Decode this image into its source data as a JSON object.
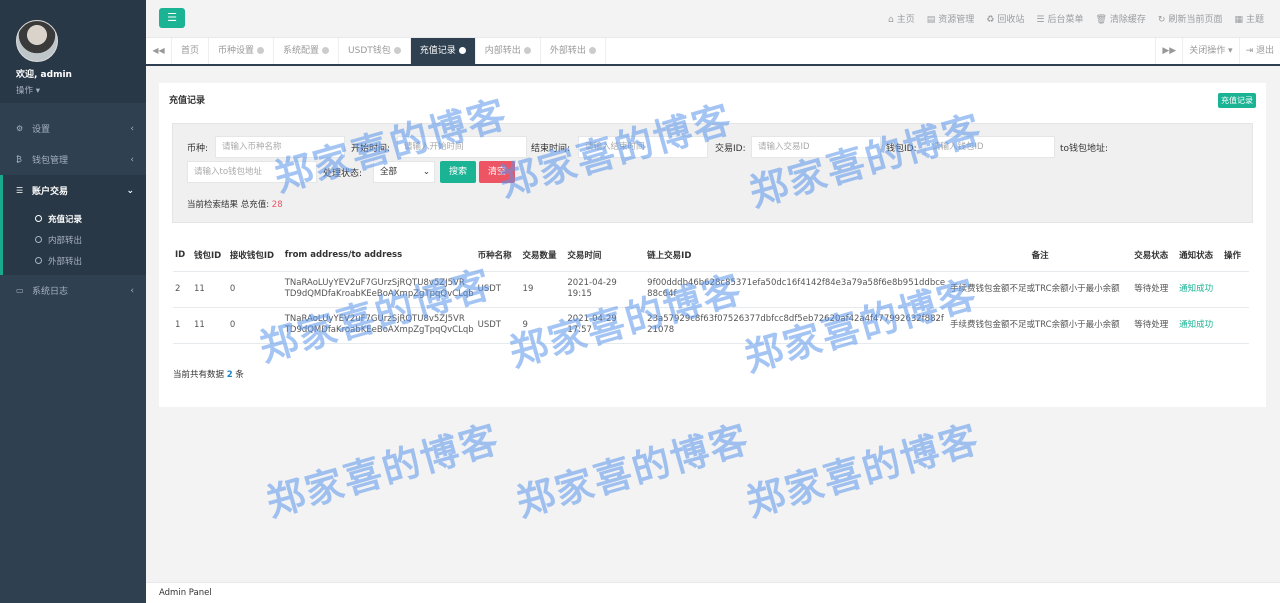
{
  "sidebar": {
    "welcome": "欢迎, admin",
    "ops": "操作 ▾",
    "menu": [
      {
        "label": "设置",
        "icon": "gears-icon"
      },
      {
        "label": "钱包管理",
        "icon": "bitcoin-icon"
      },
      {
        "label": "账户交易",
        "icon": "list-icon"
      },
      {
        "label": "系统日志",
        "icon": "desktop-icon"
      }
    ],
    "submenu": [
      "充值记录",
      "内部转出",
      "外部转出"
    ]
  },
  "topbar": {
    "links": [
      "主页",
      "资源管理",
      "回收站",
      "后台菜单",
      "清除缓存",
      "刷新当前页面",
      "主题"
    ]
  },
  "tabs": [
    "首页",
    "币种设置",
    "系统配置",
    "USDT钱包",
    "充值记录",
    "内部转出",
    "外部转出"
  ],
  "tabs_right": {
    "close_ops": "关闭操作 ▾",
    "logout": "退出"
  },
  "panel": {
    "title": "充值记录",
    "badge": "充值记录"
  },
  "search": {
    "coin_label": "币种:",
    "coin_placeholder": "请输入币种名称",
    "start_label": "开始时间:",
    "start_placeholder": "请输入开始时间",
    "end_label": "结束时间:",
    "end_placeholder": "请输入结束时间",
    "txid_label": "交易ID:",
    "txid_placeholder": "请输入交易ID",
    "wallet_label": "钱包ID:",
    "wallet_placeholder": "请输入钱包ID",
    "to_label": "to钱包地址:",
    "to_placeholder": "请输入to钱包地址",
    "status_label": "处理状态:",
    "status_value": "全部",
    "search_btn": "搜索",
    "clear_btn": "清空",
    "total_prefix": "当前检索结果 总充值:",
    "total_value": "28"
  },
  "table": {
    "headers": [
      "ID",
      "钱包ID",
      "接收钱包ID",
      "from address/to address",
      "币种名称",
      "交易数量",
      "交易时间",
      "链上交易ID",
      "备注",
      "交易状态",
      "通知状态",
      "操作"
    ],
    "rows": [
      [
        "2",
        "11",
        "0",
        "TNaRAoLUyYEV2uF7GUrzSjRQTU8v5ZJ5VR TD9dQMDfaKroabKEeBoAXmpZgTpqQvCLqb",
        "USDT",
        "19",
        "2021-04-29 19:15",
        "9f00dddb46b628c85371efa50dc16f4142f84e3a79a58f6e8b951ddbce88c64f",
        "手续费钱包金额不足或TRC余额小于最小余额",
        "等待处理",
        "通知成功",
        ""
      ],
      [
        "1",
        "11",
        "0",
        "TNaRAoLUyYEV2uF7GUrzSjRQTU8v5ZJ5VR TD9dQMDfaKroabKEeBoAXmpZgTpqQvCLqb",
        "USDT",
        "9",
        "2021-04-29 17:57",
        "23a57929c8f63f07526377dbfcc8df5eb72620af42a4f477992632f882f21078",
        "手续费钱包金额不足或TRC余额小于最小余额",
        "等待处理",
        "通知成功",
        ""
      ]
    ],
    "count_prefix": "当前共有数据",
    "count_value": "2",
    "count_suffix": "条"
  },
  "footer": "Admin Panel",
  "watermark": "郑家喜的博客",
  "colors": {
    "sidebar": "#2f4050",
    "accent": "#1ab394",
    "danger": "#ed5565"
  }
}
